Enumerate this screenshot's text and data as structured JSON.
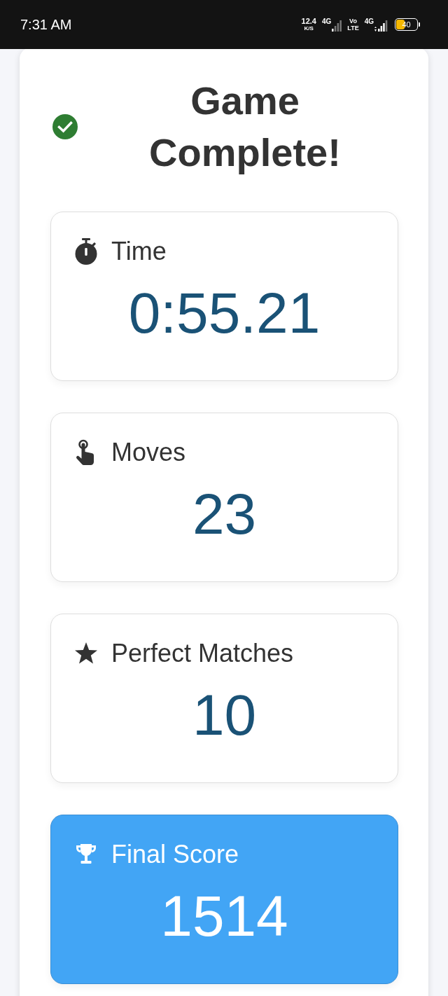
{
  "status_bar": {
    "time": "7:31 AM",
    "network_speed": "12.4",
    "network_speed_unit": "K/S",
    "sim_1_network": "4G",
    "volte_top": "Vo",
    "volte_bottom": "LTE",
    "sim_2_network": "4G",
    "battery": {
      "text": "40",
      "level": 0.4
    }
  },
  "summary": {
    "title": "Game Complete!",
    "stats": [
      {
        "kind": "time",
        "label": "Time",
        "value": "0:55.21",
        "highlighted": false
      },
      {
        "kind": "moves",
        "label": "Moves",
        "value": "23",
        "highlighted": false
      },
      {
        "kind": "perfect_matches",
        "label": "Perfect Matches",
        "value": "10",
        "highlighted": false
      },
      {
        "kind": "final_score",
        "label": "Final Score",
        "value": "1514",
        "highlighted": true
      }
    ]
  }
}
